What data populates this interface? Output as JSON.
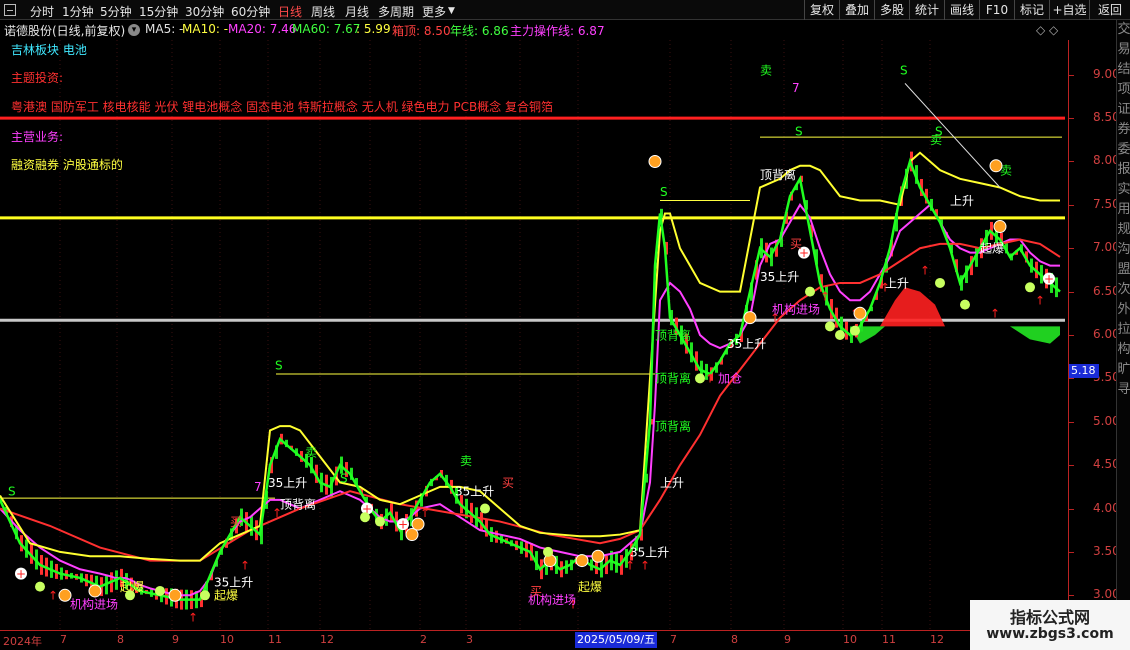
{
  "toolbar": {
    "timeframes": [
      "分时",
      "1分钟",
      "5分钟",
      "15分钟",
      "30分钟",
      "60分钟",
      "日线",
      "周线",
      "月线",
      "多周期",
      "更多"
    ],
    "active_index": 6,
    "buttons": [
      "复权",
      "叠加",
      "多股",
      "统计",
      "画线",
      "F10",
      "标记",
      "+自选",
      "返回"
    ]
  },
  "info": {
    "stock": "诺德股份(日线,前复权)",
    "ma5": "MA5: -",
    "ma10": "MA10: -",
    "ma20": "MA20: 7.46",
    "ma60": "MA60: 7.67",
    "extra": ": 5.99",
    "box_top": "箱顶: 8.50",
    "year_line": "年线: 6.86",
    "main_line": "主力操作线: 6.87",
    "colors": {
      "ma5": "#e0e0e0",
      "ma10": "#ffff40",
      "ma20": "#ff40ff",
      "ma60": "#40ff40",
      "extra": "#ffff40",
      "box_top": "#ff4040",
      "year_line": "#40ff40",
      "main_line": "#ff40ff"
    }
  },
  "overlay": {
    "sector": "吉林板块 电池",
    "theme_label": "主题投资:",
    "themes": "粤港澳 国防军工 核电核能 光伏 锂电池概念 固态电池 特斯拉概念 无人机 绿色电力 PCB概念 复合铜箔",
    "business_label": "主营业务:",
    "business": "融资融券 沪股通标的"
  },
  "axis": {
    "price_ticks": [
      "9.00",
      "8.50",
      "8.00",
      "7.50",
      "7.00",
      "6.50",
      "6.00",
      "5.50",
      "5.00",
      "4.50",
      "4.00",
      "3.50",
      "3.00"
    ],
    "current_price": "5.18",
    "date_ticks": [
      "2024年",
      "7",
      "8",
      "9",
      "10",
      "11",
      "12",
      "2",
      "3",
      "7",
      "8",
      "9",
      "10",
      "11",
      "12"
    ],
    "current_date": "2025/05/09/五"
  },
  "right_panel": {
    "chars": [
      "交",
      "易",
      "结",
      "项",
      "证",
      "券",
      "委",
      "报",
      "实",
      "用",
      "规",
      "沟",
      "盟",
      "次",
      "外",
      "拉",
      "构",
      "旷",
      "寻"
    ]
  },
  "chart_labels": {
    "buy": "买",
    "sell": "卖",
    "rise35": "35上升",
    "diverge": "顶背离",
    "boom": "起爆",
    "inst_in": "机构进场",
    "add": "加仓",
    "up": "上升",
    "n7": "7"
  },
  "watermark": {
    "line1": "指标公式网",
    "line2": "www.zbgs3.com"
  },
  "window_controls": "◇ ◇",
  "chart_data": {
    "type": "line",
    "ylim": [
      2.6,
      9.4
    ],
    "yticks": [
      9.0,
      8.5,
      8.0,
      7.5,
      7.0,
      6.5,
      6.0,
      5.5,
      5.0,
      4.5,
      4.0,
      3.5,
      3.0
    ],
    "horizontal_lines": [
      {
        "name": "箱顶",
        "y": 8.5,
        "color": "#ff2020"
      },
      {
        "y": 7.35,
        "color": "#ffff20"
      },
      {
        "y": 6.17,
        "color": "#c8c8c8"
      }
    ],
    "series": [
      {
        "name": "MA20",
        "color": "#ff40ff",
        "x": [
          0,
          20,
          40,
          60,
          80,
          100,
          110,
          115,
          120,
          125,
          130,
          135,
          140,
          150,
          160,
          170,
          180,
          190,
          200,
          210,
          220,
          230,
          240,
          250,
          260,
          270,
          280,
          290,
          300,
          310,
          320,
          330,
          340,
          350,
          360,
          370,
          380,
          390,
          400,
          410,
          420,
          440,
          460,
          480,
          500,
          520,
          540,
          560,
          580,
          600,
          620,
          640,
          650,
          655,
          660,
          670,
          680,
          690,
          700,
          710,
          720,
          730,
          740,
          750,
          760,
          770,
          780,
          790,
          800,
          810,
          820,
          830,
          840,
          850,
          860,
          870,
          880,
          890,
          900,
          910,
          920,
          930,
          940,
          950,
          960,
          970,
          980,
          990,
          1000,
          1010,
          1020,
          1030,
          1040,
          1050,
          1060
        ],
        "values": [
          4.0,
          3.75,
          3.55,
          3.4,
          3.3,
          3.25,
          3.22,
          3.2,
          3.2,
          3.2,
          3.18,
          3.15,
          3.12,
          3.08,
          3.05,
          3.02,
          3.0,
          3.0,
          3.05,
          3.2,
          3.5,
          3.7,
          3.85,
          3.9,
          4.0,
          4.1,
          4.1,
          4.05,
          4.0,
          4.05,
          4.1,
          4.15,
          4.2,
          4.15,
          4.1,
          4.0,
          3.9,
          3.85,
          3.85,
          3.9,
          4.0,
          4.05,
          3.9,
          3.75,
          3.7,
          3.65,
          3.55,
          3.5,
          3.45,
          3.45,
          3.5,
          3.7,
          4.3,
          5.2,
          6.4,
          6.6,
          6.5,
          6.3,
          6.0,
          5.9,
          5.85,
          5.9,
          6.0,
          6.2,
          6.8,
          7.05,
          7.1,
          7.3,
          7.5,
          7.35,
          7.0,
          6.7,
          6.5,
          6.4,
          6.4,
          6.5,
          6.7,
          6.9,
          7.2,
          7.3,
          7.4,
          7.5,
          7.3,
          7.1,
          7.0,
          6.95,
          6.95,
          7.0,
          7.05,
          7.1,
          7.1,
          6.95,
          6.85,
          6.8,
          6.8
        ]
      },
      {
        "name": "MA60",
        "color": "#ff3030",
        "x": [
          0,
          50,
          100,
          150,
          200,
          250,
          300,
          350,
          400,
          450,
          500,
          550,
          600,
          620,
          640,
          660,
          680,
          700,
          720,
          740,
          760,
          780,
          800,
          820,
          840,
          860,
          880,
          900,
          920,
          940,
          960,
          980,
          1000,
          1020,
          1040,
          1060
        ],
        "values": [
          4.0,
          3.8,
          3.55,
          3.4,
          3.4,
          3.75,
          4.0,
          4.2,
          4.05,
          3.95,
          3.85,
          3.7,
          3.6,
          3.65,
          3.75,
          4.1,
          4.5,
          4.85,
          5.3,
          5.6,
          5.9,
          6.2,
          6.4,
          6.55,
          6.6,
          6.6,
          6.7,
          6.85,
          7.0,
          7.05,
          7.05,
          7.0,
          7.05,
          7.1,
          7.05,
          6.9
        ]
      },
      {
        "name": "年线",
        "color": "#ffff30",
        "x": [
          0,
          30,
          60,
          90,
          120,
          150,
          180,
          200,
          210,
          220,
          240,
          260,
          270,
          280,
          290,
          300,
          320,
          340,
          360,
          380,
          400,
          420,
          440,
          460,
          480,
          500,
          520,
          540,
          560,
          580,
          600,
          620,
          640,
          650,
          660,
          665,
          670,
          680,
          700,
          720,
          740,
          760,
          780,
          790,
          800,
          810,
          820,
          840,
          860,
          880,
          900,
          910,
          920,
          940,
          960,
          980,
          1000,
          1020,
          1040,
          1060
        ],
        "values": [
          4.15,
          3.6,
          3.5,
          3.45,
          3.45,
          3.42,
          3.4,
          3.4,
          3.5,
          3.6,
          3.7,
          3.8,
          4.9,
          4.95,
          4.95,
          4.9,
          4.6,
          4.3,
          4.25,
          4.1,
          4.05,
          4.15,
          4.25,
          4.25,
          4.2,
          4.0,
          3.8,
          3.72,
          3.7,
          3.68,
          3.68,
          3.7,
          3.75,
          5.5,
          7.2,
          7.4,
          7.4,
          7.0,
          6.6,
          6.5,
          6.5,
          7.7,
          7.8,
          7.9,
          7.95,
          7.95,
          7.9,
          7.6,
          7.55,
          7.55,
          7.5,
          8.0,
          8.1,
          7.9,
          7.8,
          7.75,
          7.7,
          7.6,
          7.55,
          7.55
        ]
      },
      {
        "name": "主力操作线",
        "color": "#20ff20",
        "x": [
          0,
          20,
          40,
          60,
          80,
          100,
          120,
          140,
          160,
          180,
          200,
          220,
          240,
          260,
          270,
          280,
          290,
          300,
          310,
          320,
          330,
          340,
          350,
          360,
          370,
          380,
          390,
          400,
          410,
          420,
          430,
          440,
          450,
          460,
          470,
          480,
          490,
          500,
          510,
          520,
          530,
          540,
          550,
          560,
          570,
          580,
          590,
          600,
          610,
          620,
          630,
          640,
          650,
          655,
          660,
          665,
          670,
          680,
          690,
          700,
          710,
          720,
          730,
          740,
          750,
          760,
          770,
          780,
          790,
          800,
          810,
          820,
          830,
          840,
          850,
          860,
          870,
          880,
          890,
          900,
          910,
          920,
          930,
          940,
          950,
          960,
          970,
          980,
          990,
          1000,
          1010,
          1020,
          1030,
          1040,
          1050,
          1060
        ],
        "values": [
          4.1,
          3.6,
          3.35,
          3.25,
          3.2,
          3.1,
          3.2,
          3.05,
          3.0,
          2.95,
          2.95,
          3.5,
          3.9,
          3.7,
          4.5,
          4.8,
          4.7,
          4.6,
          4.5,
          4.3,
          4.25,
          4.5,
          4.4,
          4.2,
          4.0,
          3.85,
          3.95,
          3.75,
          3.9,
          4.1,
          4.3,
          4.4,
          4.25,
          4.05,
          3.95,
          3.85,
          3.7,
          3.65,
          3.6,
          3.55,
          3.5,
          3.3,
          3.4,
          3.3,
          3.35,
          3.45,
          3.35,
          3.3,
          3.4,
          3.35,
          3.5,
          3.7,
          5.0,
          6.8,
          7.4,
          7.0,
          6.2,
          6.0,
          5.8,
          5.6,
          5.55,
          5.7,
          5.9,
          6.0,
          6.5,
          7.0,
          6.9,
          7.1,
          7.6,
          7.8,
          7.2,
          6.6,
          6.3,
          6.1,
          6.0,
          6.1,
          6.3,
          6.6,
          7.0,
          7.6,
          8.0,
          7.7,
          7.5,
          7.3,
          7.0,
          6.6,
          6.8,
          7.0,
          7.2,
          7.1,
          6.9,
          7.0,
          6.8,
          6.7,
          6.6,
          6.5
        ]
      }
    ]
  }
}
